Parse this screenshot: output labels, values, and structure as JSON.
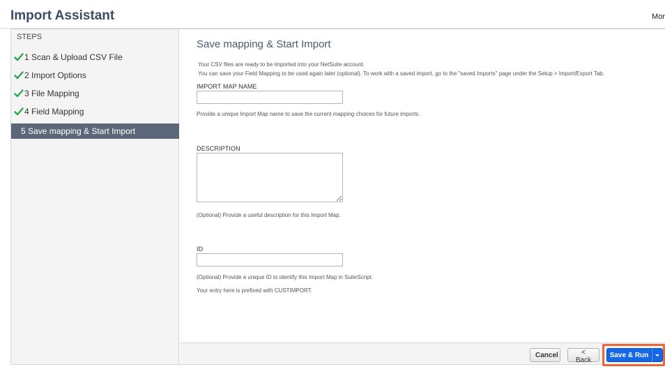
{
  "header": {
    "title": "Import Assistant",
    "more_label": "Mor"
  },
  "steps": {
    "heading": "STEPS",
    "items": [
      {
        "label": "1 Scan & Upload CSV File",
        "completed": true
      },
      {
        "label": "2 Import Options",
        "completed": true
      },
      {
        "label": "3 File Mapping",
        "completed": true
      },
      {
        "label": "4 Field Mapping",
        "completed": true
      },
      {
        "label": "5 Save mapping & Start Import",
        "active": true
      }
    ]
  },
  "main": {
    "title": "Save mapping & Start Import",
    "info_line_1": "Your CSV files are ready to be imported into your NetSuite account.",
    "info_line_2": "You can save your Field Mapping to be used again later (optional). To work with a saved import, go to the \"saved Imports\" page under the Setup > Import/Export Tab.",
    "fields": {
      "import_map_name": {
        "label": "IMPORT MAP NAME",
        "value": "",
        "help": "Provide a unique Import Map name to save the current mapping choices for future imports."
      },
      "description": {
        "label": "DESCRIPTION",
        "value": "",
        "help": "(Optional) Provide a useful description for this Import Map."
      },
      "id": {
        "label": "ID",
        "value": "",
        "help_1": "(Optional) Provide a unique ID to identify this Import Map in SuiteScript.",
        "help_2": "Your entry here is prefixed with CUSTIMPORT."
      }
    }
  },
  "footer": {
    "cancel_label": "Cancel",
    "back_label": "< Back",
    "save_run_label": "Save & Run"
  },
  "colors": {
    "accent": "#1467e5",
    "highlight": "#e8663c",
    "active_step": "#5b6778",
    "check": "#2ea44f"
  },
  "icons": {
    "step_complete": "checkmark-icon",
    "dropdown": "chevron-down-icon"
  }
}
